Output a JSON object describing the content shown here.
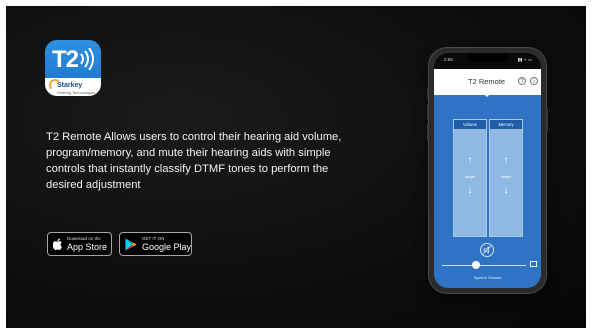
{
  "app_icon": {
    "title": "T2",
    "brand": "Starkey",
    "tagline": "Hearing Technologies"
  },
  "description": "T2 Remote Allows users to control their hearing aid volume, program/memory, and mute their hearing aids with simple controls that instantly classify DTMF tones to perform the desired adjustment",
  "badges": {
    "apple": {
      "small": "Download on the",
      "big": "App Store"
    },
    "google": {
      "small": "GET IT ON",
      "big": "Google Play"
    }
  },
  "phone": {
    "status_time": "2:58",
    "status_icons": "▮▮ ◗ ▭",
    "header_title": "T2 Remote",
    "help_icon_label": "?",
    "info_icon_label": "i",
    "volume_label": "Volume",
    "memory_label": "Memory",
    "swipe_label": "swipe",
    "system_volume_label": "System Volume",
    "system_volume_level": 0.4
  },
  "colors": {
    "slide_bg": "#0e0e0e",
    "app_blue": "#2e73c4",
    "panel_header": "#1f5da8",
    "panel_fill": "#8fb8e2"
  }
}
